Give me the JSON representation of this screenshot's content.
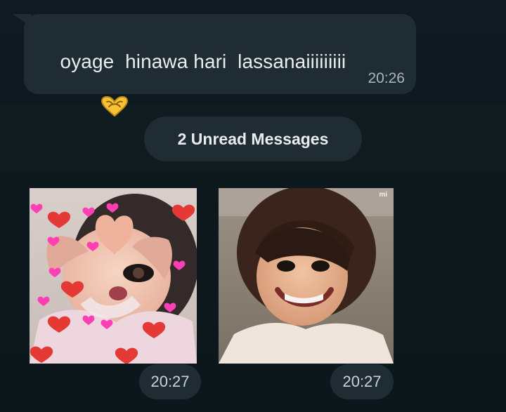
{
  "message": {
    "text": "oyage  hinawa hari  lassanaiiiiiiiii",
    "emoji": "heart-hands-icon",
    "time": "20:26"
  },
  "unread_banner": {
    "label": "2 Unread Messages"
  },
  "images": [
    {
      "time": "20:27",
      "watermark": ""
    },
    {
      "time": "20:27",
      "watermark": "mi"
    }
  ],
  "colors": {
    "background": "#0e1a1f",
    "bubble": "#1f2c33",
    "text": "#e9edef",
    "meta": "#aab5bb",
    "heart_red": "#e53935",
    "heart_pink": "#ff3fb4",
    "emoji_gold": "#f6c338"
  }
}
